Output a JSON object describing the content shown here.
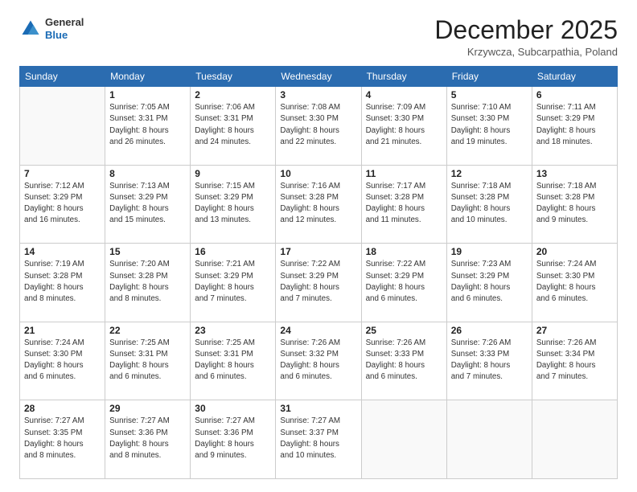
{
  "logo": {
    "general": "General",
    "blue": "Blue"
  },
  "header": {
    "month": "December 2025",
    "location": "Krzywcza, Subcarpathia, Poland"
  },
  "weekdays": [
    "Sunday",
    "Monday",
    "Tuesday",
    "Wednesday",
    "Thursday",
    "Friday",
    "Saturday"
  ],
  "weeks": [
    [
      {
        "day": "",
        "info": ""
      },
      {
        "day": "1",
        "info": "Sunrise: 7:05 AM\nSunset: 3:31 PM\nDaylight: 8 hours\nand 26 minutes."
      },
      {
        "day": "2",
        "info": "Sunrise: 7:06 AM\nSunset: 3:31 PM\nDaylight: 8 hours\nand 24 minutes."
      },
      {
        "day": "3",
        "info": "Sunrise: 7:08 AM\nSunset: 3:30 PM\nDaylight: 8 hours\nand 22 minutes."
      },
      {
        "day": "4",
        "info": "Sunrise: 7:09 AM\nSunset: 3:30 PM\nDaylight: 8 hours\nand 21 minutes."
      },
      {
        "day": "5",
        "info": "Sunrise: 7:10 AM\nSunset: 3:30 PM\nDaylight: 8 hours\nand 19 minutes."
      },
      {
        "day": "6",
        "info": "Sunrise: 7:11 AM\nSunset: 3:29 PM\nDaylight: 8 hours\nand 18 minutes."
      }
    ],
    [
      {
        "day": "7",
        "info": "Sunrise: 7:12 AM\nSunset: 3:29 PM\nDaylight: 8 hours\nand 16 minutes."
      },
      {
        "day": "8",
        "info": "Sunrise: 7:13 AM\nSunset: 3:29 PM\nDaylight: 8 hours\nand 15 minutes."
      },
      {
        "day": "9",
        "info": "Sunrise: 7:15 AM\nSunset: 3:29 PM\nDaylight: 8 hours\nand 13 minutes."
      },
      {
        "day": "10",
        "info": "Sunrise: 7:16 AM\nSunset: 3:28 PM\nDaylight: 8 hours\nand 12 minutes."
      },
      {
        "day": "11",
        "info": "Sunrise: 7:17 AM\nSunset: 3:28 PM\nDaylight: 8 hours\nand 11 minutes."
      },
      {
        "day": "12",
        "info": "Sunrise: 7:18 AM\nSunset: 3:28 PM\nDaylight: 8 hours\nand 10 minutes."
      },
      {
        "day": "13",
        "info": "Sunrise: 7:18 AM\nSunset: 3:28 PM\nDaylight: 8 hours\nand 9 minutes."
      }
    ],
    [
      {
        "day": "14",
        "info": "Sunrise: 7:19 AM\nSunset: 3:28 PM\nDaylight: 8 hours\nand 8 minutes."
      },
      {
        "day": "15",
        "info": "Sunrise: 7:20 AM\nSunset: 3:28 PM\nDaylight: 8 hours\nand 8 minutes."
      },
      {
        "day": "16",
        "info": "Sunrise: 7:21 AM\nSunset: 3:29 PM\nDaylight: 8 hours\nand 7 minutes."
      },
      {
        "day": "17",
        "info": "Sunrise: 7:22 AM\nSunset: 3:29 PM\nDaylight: 8 hours\nand 7 minutes."
      },
      {
        "day": "18",
        "info": "Sunrise: 7:22 AM\nSunset: 3:29 PM\nDaylight: 8 hours\nand 6 minutes."
      },
      {
        "day": "19",
        "info": "Sunrise: 7:23 AM\nSunset: 3:29 PM\nDaylight: 8 hours\nand 6 minutes."
      },
      {
        "day": "20",
        "info": "Sunrise: 7:24 AM\nSunset: 3:30 PM\nDaylight: 8 hours\nand 6 minutes."
      }
    ],
    [
      {
        "day": "21",
        "info": "Sunrise: 7:24 AM\nSunset: 3:30 PM\nDaylight: 8 hours\nand 6 minutes."
      },
      {
        "day": "22",
        "info": "Sunrise: 7:25 AM\nSunset: 3:31 PM\nDaylight: 8 hours\nand 6 minutes."
      },
      {
        "day": "23",
        "info": "Sunrise: 7:25 AM\nSunset: 3:31 PM\nDaylight: 8 hours\nand 6 minutes."
      },
      {
        "day": "24",
        "info": "Sunrise: 7:26 AM\nSunset: 3:32 PM\nDaylight: 8 hours\nand 6 minutes."
      },
      {
        "day": "25",
        "info": "Sunrise: 7:26 AM\nSunset: 3:33 PM\nDaylight: 8 hours\nand 6 minutes."
      },
      {
        "day": "26",
        "info": "Sunrise: 7:26 AM\nSunset: 3:33 PM\nDaylight: 8 hours\nand 7 minutes."
      },
      {
        "day": "27",
        "info": "Sunrise: 7:26 AM\nSunset: 3:34 PM\nDaylight: 8 hours\nand 7 minutes."
      }
    ],
    [
      {
        "day": "28",
        "info": "Sunrise: 7:27 AM\nSunset: 3:35 PM\nDaylight: 8 hours\nand 8 minutes."
      },
      {
        "day": "29",
        "info": "Sunrise: 7:27 AM\nSunset: 3:36 PM\nDaylight: 8 hours\nand 8 minutes."
      },
      {
        "day": "30",
        "info": "Sunrise: 7:27 AM\nSunset: 3:36 PM\nDaylight: 8 hours\nand 9 minutes."
      },
      {
        "day": "31",
        "info": "Sunrise: 7:27 AM\nSunset: 3:37 PM\nDaylight: 8 hours\nand 10 minutes."
      },
      {
        "day": "",
        "info": ""
      },
      {
        "day": "",
        "info": ""
      },
      {
        "day": "",
        "info": ""
      }
    ]
  ]
}
